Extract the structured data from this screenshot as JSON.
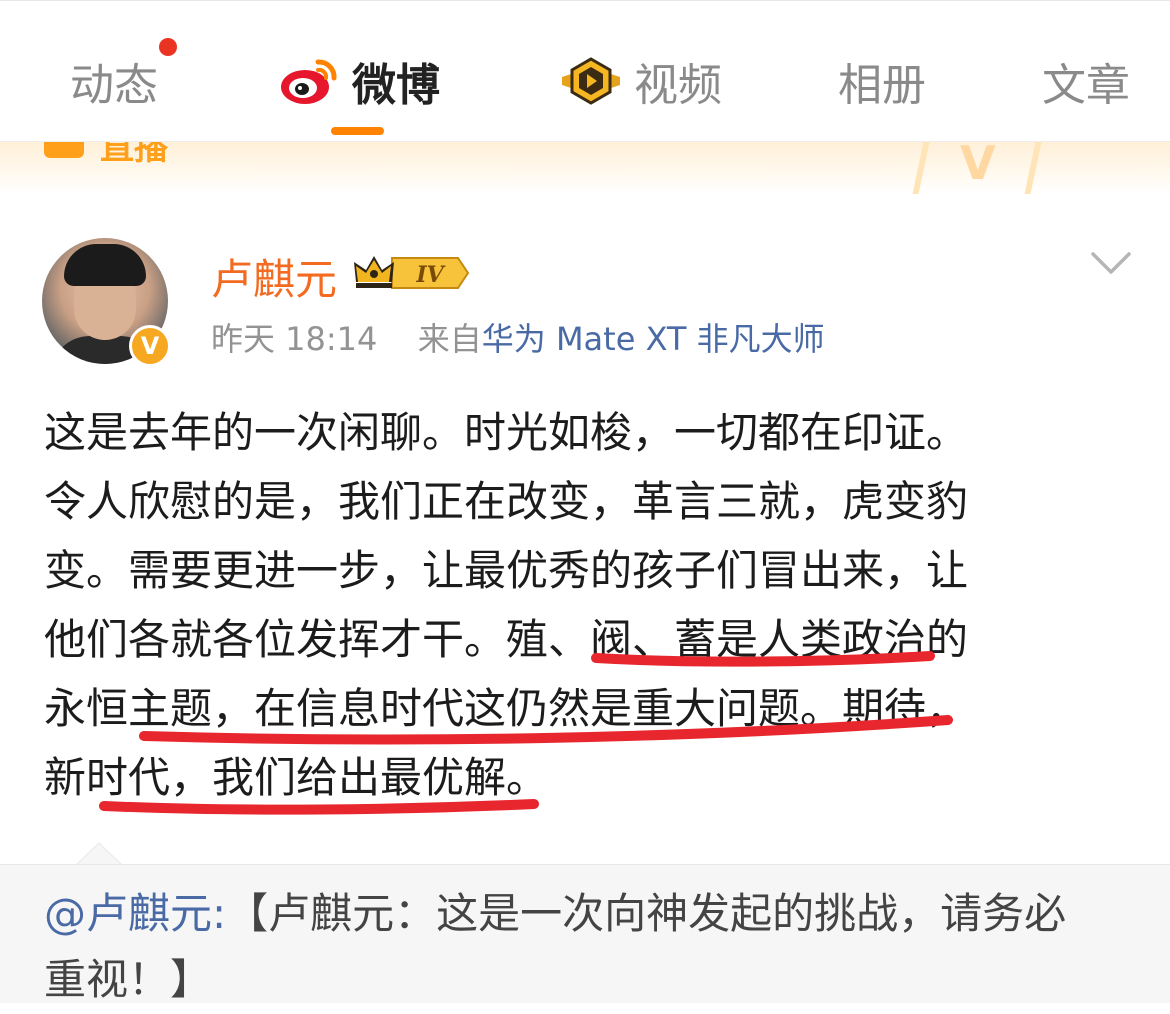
{
  "tabs": [
    {
      "label": "动态",
      "active": false
    },
    {
      "label": "微博",
      "active": true
    },
    {
      "label": "视频",
      "active": false
    },
    {
      "label": "相册",
      "active": false
    },
    {
      "label": "文章",
      "active": false
    }
  ],
  "banner": {
    "label": "直播"
  },
  "post": {
    "author": "卢麒元",
    "level": "IV",
    "time": "昨天 18:14",
    "source_prefix": "来自",
    "source": "华为 Mate XT 非凡大师",
    "verified_mark": "V",
    "lines": [
      "这是去年的一次闲聊。时光如梭，一切都在印证。",
      "令人欣慰的是，我们正在改变，革言三就，虎变豹",
      "变。需要更进一步，让最优秀的孩子们冒出来，让",
      "他们各就各位发挥才干。殖、阀、蓄是人类政治的",
      "永恒主题，在信息时代这仍然是重大问题。期待，",
      "新时代，我们给出最优解。"
    ]
  },
  "repost": {
    "mention": "@卢麒元:",
    "line1_rest": "【卢麒元：这是一次向神发起的挑战，请务必",
    "line2": "重视！】"
  },
  "colors": {
    "accent": "#ff8200",
    "author": "#f36b21",
    "link": "#4a6aa5",
    "annotation": "#e8262e",
    "notification_dot": "#ea3323"
  },
  "icons": [
    "weibo-logo-icon",
    "video-badge-icon",
    "crown-level-icon",
    "chevron-down-icon",
    "verified-badge-icon"
  ]
}
